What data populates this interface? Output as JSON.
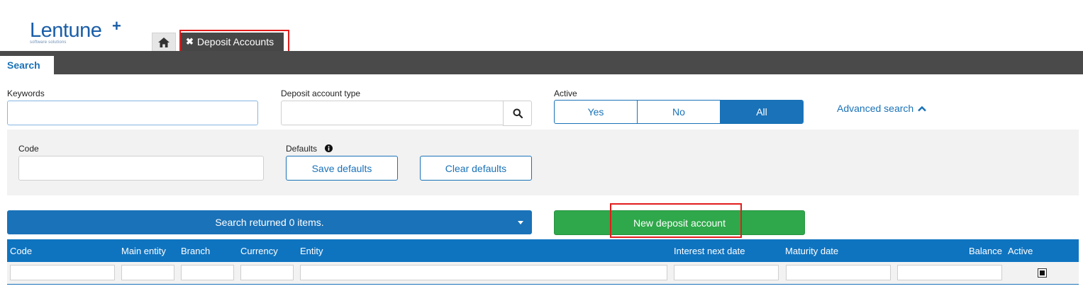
{
  "logo": {
    "name": "Lentune",
    "plus": "+",
    "tagline": "software solutions"
  },
  "tabs": {
    "home_icon": "home-icon",
    "doc_tab_close": "✖",
    "doc_tab_label": "Deposit Accounts"
  },
  "search_tab": "Search",
  "filters": {
    "keywords_label": "Keywords",
    "keywords_value": "",
    "type_label": "Deposit account type",
    "type_value": "",
    "active_label": "Active",
    "active_options": [
      "Yes",
      "No",
      "All"
    ],
    "active_selected": "All",
    "advanced_label": "Advanced search"
  },
  "advanced": {
    "code_label": "Code",
    "code_value": "",
    "defaults_label": "Defaults",
    "save_defaults": "Save defaults",
    "clear_defaults": "Clear defaults"
  },
  "results": {
    "summary": "Search returned 0 items.",
    "new_button": "New deposit account"
  },
  "table": {
    "columns": [
      "Code",
      "Main entity",
      "Branch",
      "Currency",
      "Entity",
      "Interest next date",
      "Maturity date",
      "Balance",
      "Active"
    ],
    "active_filter_checked": true
  },
  "colors": {
    "primary": "#1a72b8",
    "header": "#0f74c0",
    "success": "#2ea84a",
    "highlight": "#e31c1c",
    "dark_bar": "#4a4a4a"
  }
}
